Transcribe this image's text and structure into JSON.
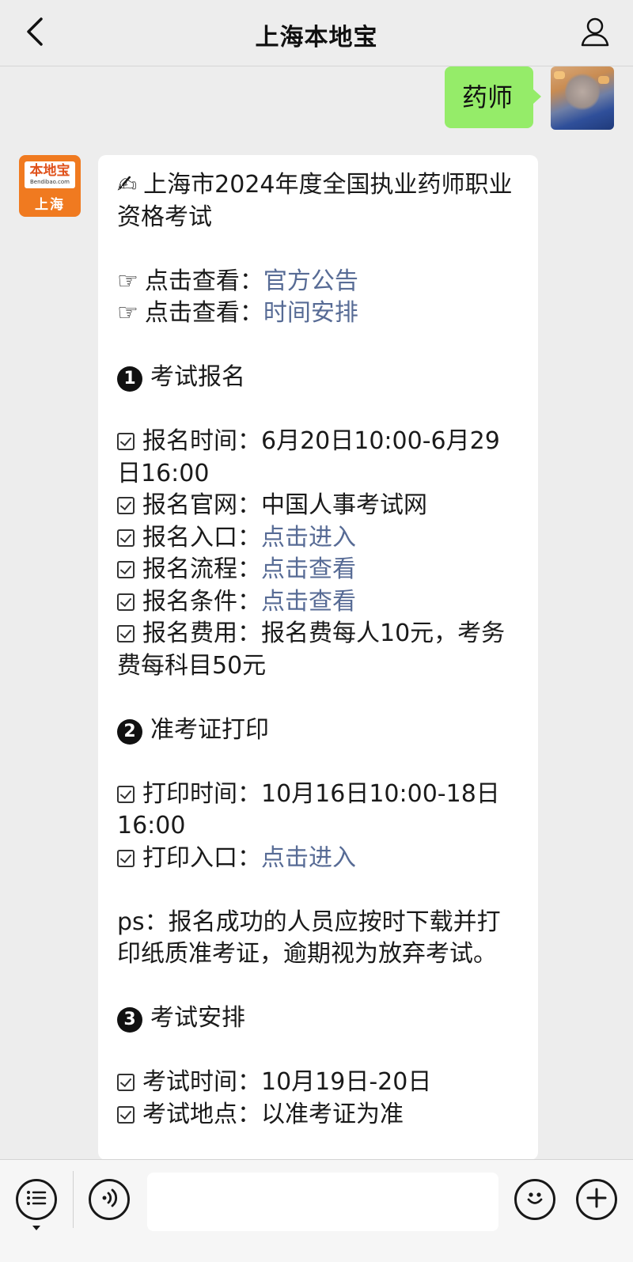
{
  "header": {
    "title": "上海本地宝",
    "back_icon": "chevron-left-icon",
    "profile_icon": "person-icon"
  },
  "user_message": {
    "text": "药师",
    "bubble_color": "#95ec69"
  },
  "bot": {
    "logo_main": "本地宝",
    "logo_url": "Bendibao.com",
    "logo_city": "上海",
    "brand_color": "#f07a20"
  },
  "message": {
    "title_emoji": "✍",
    "title": "上海市2024年度全国执业药师职业资格考试",
    "pointer_emoji": "☞",
    "view_label": "点击查看：",
    "links_top": [
      "官方公告",
      "时间安排"
    ],
    "sections": [
      {
        "num": "❶",
        "heading": "考试报名",
        "items": [
          {
            "label": "报名时间：",
            "value": "6月20日10:00-6月29日16:00",
            "link": false
          },
          {
            "label": "报名官网：",
            "value": "中国人事考试网",
            "link": false
          },
          {
            "label": "报名入口：",
            "value": "点击进入",
            "link": true
          },
          {
            "label": "报名流程：",
            "value": "点击查看",
            "link": true
          },
          {
            "label": "报名条件：",
            "value": "点击查看",
            "link": true
          },
          {
            "label": "报名费用：",
            "value": "报名费每人10元，考务费每科目50元",
            "link": false
          }
        ]
      },
      {
        "num": "❷",
        "heading": "准考证打印",
        "items": [
          {
            "label": "打印时间：",
            "value": "10月16日10:00-18日16:00",
            "link": false
          },
          {
            "label": "打印入口：",
            "value": "点击进入",
            "link": true
          }
        ],
        "note": "ps：报名成功的人员应按时下载并打印纸质准考证，逾期视为放弃考试。"
      },
      {
        "num": "❸",
        "heading": "考试安排",
        "items": [
          {
            "label": "考试时间：",
            "value": "10月19日-20日",
            "link": false
          },
          {
            "label": "考试地点：",
            "value": "以准考证为准",
            "link": false
          }
        ]
      }
    ],
    "link_color": "#576b95"
  },
  "toolbar": {
    "menu_icon": "list-menu-icon",
    "voice_icon": "voice-icon",
    "emoji_icon": "smiley-icon",
    "plus_icon": "plus-icon",
    "input_placeholder": ""
  }
}
